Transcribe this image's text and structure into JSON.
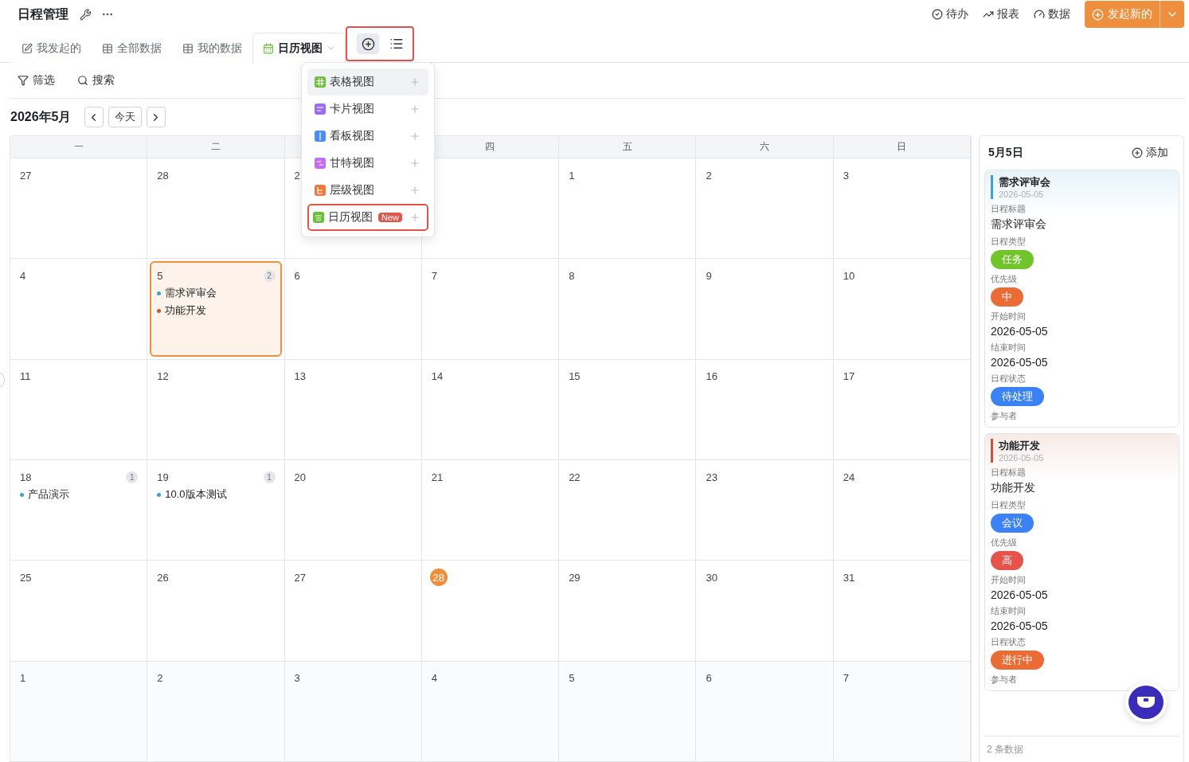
{
  "header": {
    "title": "日程管理",
    "actions": [
      {
        "label": "待办",
        "kind": "todo"
      },
      {
        "label": "报表",
        "kind": "report"
      },
      {
        "label": "数据",
        "kind": "data"
      }
    ],
    "primary_button": "发起新的"
  },
  "tabs": [
    {
      "label": "我发起的",
      "kind": "mine",
      "selected": false
    },
    {
      "label": "全部数据",
      "kind": "table",
      "selected": false
    },
    {
      "label": "我的数据",
      "kind": "table",
      "selected": false
    },
    {
      "label": "日历视图",
      "kind": "calendar",
      "selected": true
    }
  ],
  "view_menu": {
    "items": [
      {
        "label": "表格视图",
        "kind": "table",
        "color": "#6cbf3a",
        "highlighted": true,
        "outlined": false
      },
      {
        "label": "卡片视图",
        "kind": "card",
        "color": "#9b6cf0",
        "highlighted": false,
        "outlined": false
      },
      {
        "label": "看板视图",
        "kind": "kanban",
        "color": "#4a8cf7",
        "highlighted": false,
        "outlined": false
      },
      {
        "label": "甘特视图",
        "kind": "gantt",
        "color": "#c26ef0",
        "highlighted": false,
        "outlined": false
      },
      {
        "label": "层级视图",
        "kind": "tree",
        "color": "#ec7a3c",
        "highlighted": false,
        "outlined": false
      },
      {
        "label": "日历视图",
        "kind": "calendar",
        "color": "#6cbf3a",
        "highlighted": false,
        "outlined": true,
        "badge": "New"
      }
    ]
  },
  "toolbar": [
    {
      "label": "筛选",
      "kind": "filter"
    },
    {
      "label": "搜索",
      "kind": "search"
    }
  ],
  "month": {
    "title": "2026年5月",
    "today_button": "今天"
  },
  "weekdays": [
    {
      "label": "一"
    },
    {
      "label": "二"
    },
    {
      "hidden": true
    },
    {
      "label": "四"
    },
    {
      "label": "五"
    },
    {
      "label": "六"
    },
    {
      "label": "日"
    }
  ],
  "weeks": [
    [
      {
        "day": "27"
      },
      {
        "day": "28"
      },
      {
        "day": "2"
      },
      {
        "hidden": true
      },
      {
        "day": "1"
      },
      {
        "day": "2"
      },
      {
        "day": "3"
      }
    ],
    [
      {
        "day": "4"
      },
      {
        "day": "5",
        "count": "2",
        "selected": true,
        "events": [
          {
            "title": "需求评审会",
            "color": "#3ea0cc"
          },
          {
            "title": "功能开发",
            "color": "#c4553a"
          }
        ]
      },
      {
        "day": "6"
      },
      {
        "day": "7"
      },
      {
        "day": "8"
      },
      {
        "day": "9"
      },
      {
        "day": "10"
      }
    ],
    [
      {
        "day": "11"
      },
      {
        "day": "12"
      },
      {
        "day": "13"
      },
      {
        "day": "14"
      },
      {
        "day": "15"
      },
      {
        "day": "16"
      },
      {
        "day": "17"
      }
    ],
    [
      {
        "day": "18",
        "count": "1",
        "events": [
          {
            "title": "产品演示",
            "color": "#3ea0cc"
          }
        ]
      },
      {
        "day": "19",
        "count": "1",
        "events": [
          {
            "title": "10.0版本测试",
            "color": "#3ea0cc"
          }
        ]
      },
      {
        "day": "20"
      },
      {
        "day": "21"
      },
      {
        "day": "22"
      },
      {
        "day": "23"
      },
      {
        "day": "24"
      }
    ],
    [
      {
        "day": "25"
      },
      {
        "day": "26"
      },
      {
        "day": "27"
      },
      {
        "day": "28",
        "today": true
      },
      {
        "day": "29"
      },
      {
        "day": "30"
      },
      {
        "day": "31"
      }
    ],
    [
      {
        "day": "1"
      },
      {
        "day": "2"
      },
      {
        "day": "3"
      },
      {
        "day": "4"
      },
      {
        "day": "5"
      },
      {
        "day": "6"
      },
      {
        "day": "7"
      }
    ]
  ],
  "side_panel": {
    "title": "5月5日",
    "add_button": "添加",
    "footer": "2 条数据",
    "cards": [
      {
        "title": "需求评审会",
        "date": "2026-05-05",
        "color": "#3ea0cc",
        "fields": [
          {
            "label": "日程标题",
            "kind": "text",
            "value": "需求评审会"
          },
          {
            "label": "日程类型",
            "kind": "tag",
            "value": "任务",
            "color": "#72c42c"
          },
          {
            "label": "优先级",
            "kind": "tag",
            "value": "中",
            "color": "#eb6b35"
          },
          {
            "label": "开始时间",
            "kind": "text",
            "value": "2026-05-05"
          },
          {
            "label": "结束时间",
            "kind": "text",
            "value": "2026-05-05"
          },
          {
            "label": "日程状态",
            "kind": "tag",
            "value": "待处理",
            "color": "#3b82f6"
          },
          {
            "label": "参与者",
            "kind": "empty"
          }
        ]
      },
      {
        "title": "功能开发",
        "date": "2026-05-05",
        "color": "#c4553a",
        "fields": [
          {
            "label": "日程标题",
            "kind": "text",
            "value": "功能开发"
          },
          {
            "label": "日程类型",
            "kind": "tag",
            "value": "会议",
            "color": "#3b82f6"
          },
          {
            "label": "优先级",
            "kind": "tag",
            "value": "高",
            "color": "#e5534b"
          },
          {
            "label": "开始时间",
            "kind": "text",
            "value": "2026-05-05"
          },
          {
            "label": "结束时间",
            "kind": "text",
            "value": "2026-05-05"
          },
          {
            "label": "日程状态",
            "kind": "tag",
            "value": "进行中",
            "color": "#eb6b35"
          },
          {
            "label": "参与者",
            "kind": "empty"
          }
        ]
      }
    ]
  }
}
